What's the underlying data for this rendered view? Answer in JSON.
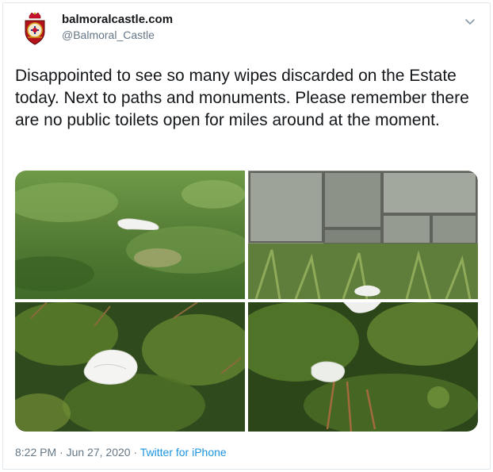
{
  "user": {
    "display_name": "balmoralcastle.com",
    "handle": "@Balmoral_Castle",
    "avatar_icon": "royal-crest-icon"
  },
  "tweet": {
    "text": "Disappointed to see so many wipes discarded on the Estate today. Next to paths and monuments. Please remember there are no public toilets open for miles around at the moment."
  },
  "media": {
    "photos": [
      {
        "subject": "wipe on grass"
      },
      {
        "subject": "wipe by stone wall"
      },
      {
        "subject": "wipe in heather"
      },
      {
        "subject": "wipe in heather"
      }
    ]
  },
  "meta": {
    "time": "8:22 PM",
    "separator": "·",
    "date": "Jun 27, 2020",
    "source": "Twitter for iPhone"
  },
  "colors": {
    "text": "#14171a",
    "muted": "#657786",
    "link": "#1b95e0"
  }
}
